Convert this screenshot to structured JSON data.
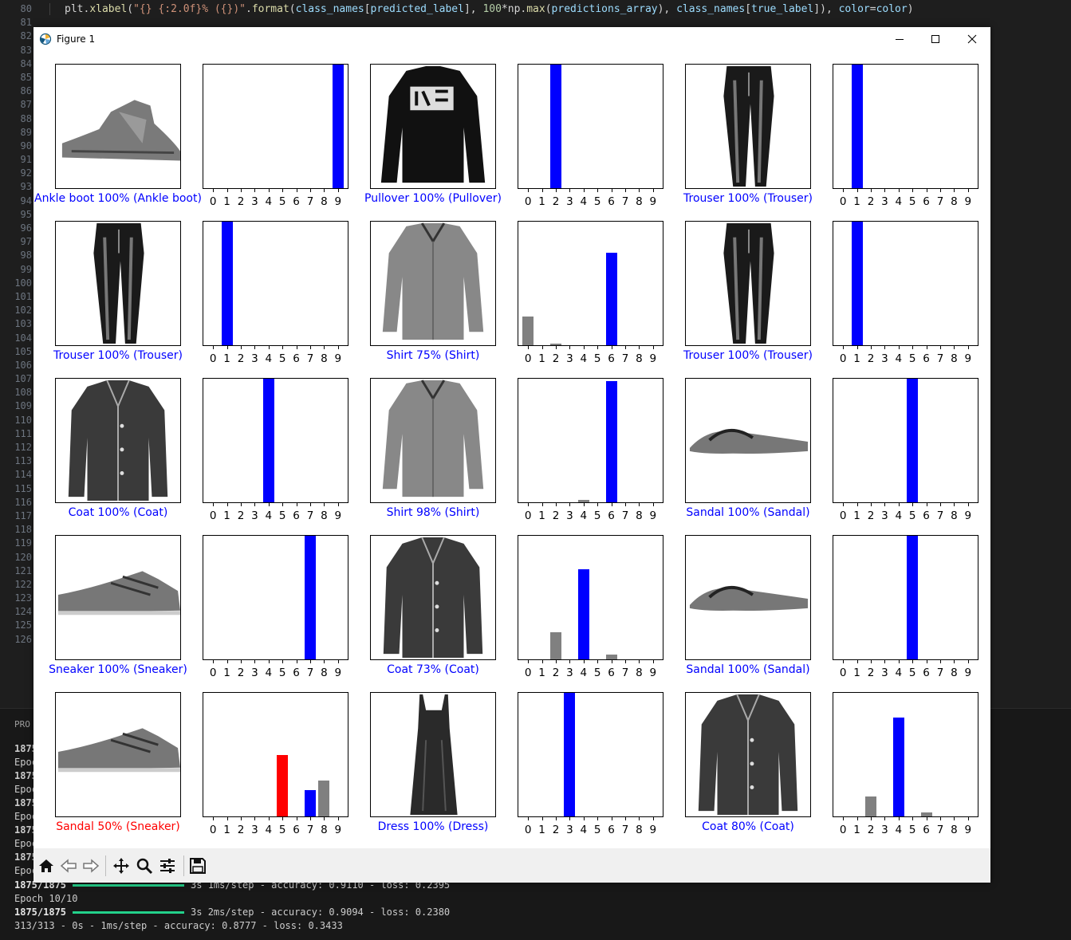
{
  "editor": {
    "line_numbers": [
      "80",
      "81",
      "82",
      "83",
      "84",
      "85",
      "86",
      "87",
      "88",
      "89",
      "90",
      "91",
      "92",
      "93",
      "94",
      "95",
      "96",
      "97",
      "98",
      "99",
      "100",
      "101",
      "102",
      "103",
      "104",
      "105",
      "106",
      "107",
      "108",
      "109",
      "110",
      "111",
      "112",
      "113",
      "114",
      "115",
      "116",
      "117",
      "118",
      "119",
      "120",
      "121",
      "122",
      "123",
      "124",
      "125",
      "126"
    ],
    "code_line": {
      "a": "plt.",
      "b": "xlabel",
      "c": "(",
      "d": "\"{} {:2.0f}% ({})\"",
      "e": ".",
      "f": "format",
      "g": "(",
      "h": "class_names",
      "i": "[",
      "j": "predicted_label",
      "k": "], ",
      "l": "100",
      "m": "*np.",
      "n": "max",
      "o": "(",
      "p": "predictions_array",
      "q": "), ",
      "r": "class_names",
      "s": "[",
      "t": "true_label",
      "u": "]), ",
      "v": "color",
      "w": "=",
      "x": "color",
      "y": ")"
    }
  },
  "terminal": {
    "tab_partial": "PRO",
    "partial_lines": [
      "1875",
      "Epoc",
      "1875",
      "Epoc",
      "1875",
      "Epoc",
      "1875",
      "Epoc",
      "1875",
      "Epoc"
    ],
    "line_a_prefix": "1875/1875",
    "line_a_rest": "3s 1ms/step - accuracy: 0.9110 - loss: 0.2395",
    "line_b": "Epoch 10/10",
    "line_c_prefix": "1875/1875",
    "line_c_rest": "3s 2ms/step - accuracy: 0.9094 - loss: 0.2380",
    "line_d": "313/313 - 0s - 1ms/step - accuracy: 0.8777 - loss: 0.3433"
  },
  "window": {
    "title": "Figure 1",
    "icons": {
      "app": "matplotlib-icon",
      "minimize": "minimize-icon",
      "maximize": "maximize-icon",
      "close": "close-icon"
    }
  },
  "toolbar": {
    "icons": [
      "home-icon",
      "back-icon",
      "forward-icon",
      "pan-icon",
      "zoom-icon",
      "configure-icon",
      "save-icon"
    ]
  },
  "colors": {
    "correct": "#0000ff",
    "wrong": "#ff0000",
    "other": "#808080",
    "label_correct": "#0000ff",
    "label_wrong": "#ff0000"
  },
  "chart_data": {
    "type": "bar",
    "categories": [
      "0",
      "1",
      "2",
      "3",
      "4",
      "5",
      "6",
      "7",
      "8",
      "9"
    ],
    "ylim": [
      0,
      1
    ],
    "grid": false,
    "panels": [
      {
        "image": "ankle boot",
        "label": "Ankle boot 100% (Ankle boot)",
        "correct": true,
        "predicted": 9,
        "true": 9,
        "values": [
          0,
          0,
          0,
          0,
          0,
          0,
          0,
          0,
          0,
          1.0
        ]
      },
      {
        "image": "pullover",
        "label": "Pullover 100% (Pullover)",
        "correct": true,
        "predicted": 2,
        "true": 2,
        "values": [
          0,
          0,
          1.0,
          0,
          0,
          0,
          0,
          0,
          0,
          0
        ]
      },
      {
        "image": "trouser",
        "label": "Trouser 100% (Trouser)",
        "correct": true,
        "predicted": 1,
        "true": 1,
        "values": [
          0,
          1.0,
          0,
          0,
          0,
          0,
          0,
          0,
          0,
          0
        ]
      },
      {
        "image": "trouser",
        "label": "Trouser 100% (Trouser)",
        "correct": true,
        "predicted": 1,
        "true": 1,
        "values": [
          0,
          1.0,
          0,
          0,
          0,
          0,
          0,
          0,
          0,
          0
        ]
      },
      {
        "image": "shirt",
        "label": "Shirt 75% (Shirt)",
        "correct": true,
        "predicted": 6,
        "true": 6,
        "values": [
          0.23,
          0,
          0.01,
          0,
          0,
          0,
          0.75,
          0,
          0,
          0
        ]
      },
      {
        "image": "trouser",
        "label": "Trouser 100% (Trouser)",
        "correct": true,
        "predicted": 1,
        "true": 1,
        "values": [
          0,
          1.0,
          0,
          0,
          0,
          0,
          0,
          0,
          0,
          0
        ]
      },
      {
        "image": "coat",
        "label": "Coat 100% (Coat)",
        "correct": true,
        "predicted": 4,
        "true": 4,
        "values": [
          0,
          0,
          0,
          0,
          1.0,
          0,
          0,
          0,
          0,
          0
        ]
      },
      {
        "image": "shirt",
        "label": "Shirt 98% (Shirt)",
        "correct": true,
        "predicted": 6,
        "true": 6,
        "values": [
          0,
          0,
          0,
          0,
          0.02,
          0,
          0.98,
          0,
          0,
          0
        ]
      },
      {
        "image": "sandal",
        "label": "Sandal 100% (Sandal)",
        "correct": true,
        "predicted": 5,
        "true": 5,
        "values": [
          0,
          0,
          0,
          0,
          0,
          1.0,
          0,
          0,
          0,
          0
        ]
      },
      {
        "image": "sneaker",
        "label": "Sneaker 100% (Sneaker)",
        "correct": true,
        "predicted": 7,
        "true": 7,
        "values": [
          0,
          0,
          0,
          0,
          0,
          0,
          0,
          1.0,
          0,
          0
        ]
      },
      {
        "image": "coat",
        "label": "Coat 73% (Coat)",
        "correct": true,
        "predicted": 4,
        "true": 4,
        "values": [
          0,
          0,
          0.22,
          0,
          0.73,
          0,
          0.04,
          0,
          0,
          0
        ]
      },
      {
        "image": "sandal",
        "label": "Sandal 100% (Sandal)",
        "correct": true,
        "predicted": 5,
        "true": 5,
        "values": [
          0,
          0,
          0,
          0,
          0,
          1.0,
          0,
          0,
          0,
          0
        ]
      },
      {
        "image": "sneaker",
        "label": "Sandal 50% (Sneaker)",
        "correct": false,
        "predicted": 5,
        "true": 7,
        "values": [
          0,
          0,
          0,
          0,
          0,
          0.5,
          0,
          0.21,
          0.29,
          0
        ]
      },
      {
        "image": "dress",
        "label": "Dress 100% (Dress)",
        "correct": true,
        "predicted": 3,
        "true": 3,
        "values": [
          0,
          0,
          0,
          1.0,
          0,
          0,
          0,
          0,
          0,
          0
        ]
      },
      {
        "image": "coat",
        "label": "Coat 80% (Coat)",
        "correct": true,
        "predicted": 4,
        "true": 4,
        "values": [
          0,
          0,
          0.16,
          0,
          0.8,
          0,
          0.03,
          0,
          0,
          0
        ]
      }
    ]
  }
}
